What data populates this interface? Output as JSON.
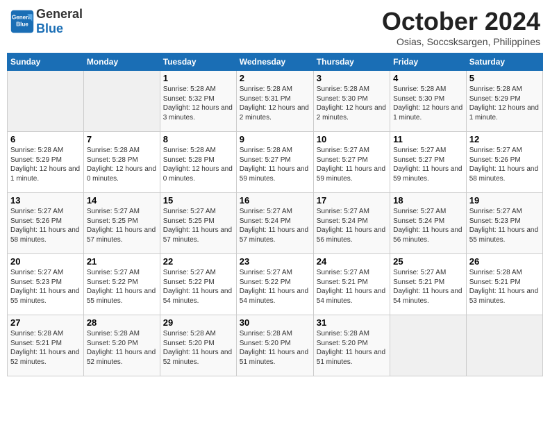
{
  "header": {
    "logo_general": "General",
    "logo_blue": "Blue",
    "month_title": "October 2024",
    "subtitle": "Osias, Soccsksargen, Philippines"
  },
  "days_of_week": [
    "Sunday",
    "Monday",
    "Tuesday",
    "Wednesday",
    "Thursday",
    "Friday",
    "Saturday"
  ],
  "weeks": [
    [
      {
        "day": "",
        "info": ""
      },
      {
        "day": "",
        "info": ""
      },
      {
        "day": "1",
        "info": "Sunrise: 5:28 AM\nSunset: 5:32 PM\nDaylight: 12 hours and 3 minutes."
      },
      {
        "day": "2",
        "info": "Sunrise: 5:28 AM\nSunset: 5:31 PM\nDaylight: 12 hours and 2 minutes."
      },
      {
        "day": "3",
        "info": "Sunrise: 5:28 AM\nSunset: 5:30 PM\nDaylight: 12 hours and 2 minutes."
      },
      {
        "day": "4",
        "info": "Sunrise: 5:28 AM\nSunset: 5:30 PM\nDaylight: 12 hours and 1 minute."
      },
      {
        "day": "5",
        "info": "Sunrise: 5:28 AM\nSunset: 5:29 PM\nDaylight: 12 hours and 1 minute."
      }
    ],
    [
      {
        "day": "6",
        "info": "Sunrise: 5:28 AM\nSunset: 5:29 PM\nDaylight: 12 hours and 1 minute."
      },
      {
        "day": "7",
        "info": "Sunrise: 5:28 AM\nSunset: 5:28 PM\nDaylight: 12 hours and 0 minutes."
      },
      {
        "day": "8",
        "info": "Sunrise: 5:28 AM\nSunset: 5:28 PM\nDaylight: 12 hours and 0 minutes."
      },
      {
        "day": "9",
        "info": "Sunrise: 5:28 AM\nSunset: 5:27 PM\nDaylight: 11 hours and 59 minutes."
      },
      {
        "day": "10",
        "info": "Sunrise: 5:27 AM\nSunset: 5:27 PM\nDaylight: 11 hours and 59 minutes."
      },
      {
        "day": "11",
        "info": "Sunrise: 5:27 AM\nSunset: 5:27 PM\nDaylight: 11 hours and 59 minutes."
      },
      {
        "day": "12",
        "info": "Sunrise: 5:27 AM\nSunset: 5:26 PM\nDaylight: 11 hours and 58 minutes."
      }
    ],
    [
      {
        "day": "13",
        "info": "Sunrise: 5:27 AM\nSunset: 5:26 PM\nDaylight: 11 hours and 58 minutes."
      },
      {
        "day": "14",
        "info": "Sunrise: 5:27 AM\nSunset: 5:25 PM\nDaylight: 11 hours and 57 minutes."
      },
      {
        "day": "15",
        "info": "Sunrise: 5:27 AM\nSunset: 5:25 PM\nDaylight: 11 hours and 57 minutes."
      },
      {
        "day": "16",
        "info": "Sunrise: 5:27 AM\nSunset: 5:24 PM\nDaylight: 11 hours and 57 minutes."
      },
      {
        "day": "17",
        "info": "Sunrise: 5:27 AM\nSunset: 5:24 PM\nDaylight: 11 hours and 56 minutes."
      },
      {
        "day": "18",
        "info": "Sunrise: 5:27 AM\nSunset: 5:24 PM\nDaylight: 11 hours and 56 minutes."
      },
      {
        "day": "19",
        "info": "Sunrise: 5:27 AM\nSunset: 5:23 PM\nDaylight: 11 hours and 55 minutes."
      }
    ],
    [
      {
        "day": "20",
        "info": "Sunrise: 5:27 AM\nSunset: 5:23 PM\nDaylight: 11 hours and 55 minutes."
      },
      {
        "day": "21",
        "info": "Sunrise: 5:27 AM\nSunset: 5:22 PM\nDaylight: 11 hours and 55 minutes."
      },
      {
        "day": "22",
        "info": "Sunrise: 5:27 AM\nSunset: 5:22 PM\nDaylight: 11 hours and 54 minutes."
      },
      {
        "day": "23",
        "info": "Sunrise: 5:27 AM\nSunset: 5:22 PM\nDaylight: 11 hours and 54 minutes."
      },
      {
        "day": "24",
        "info": "Sunrise: 5:27 AM\nSunset: 5:21 PM\nDaylight: 11 hours and 54 minutes."
      },
      {
        "day": "25",
        "info": "Sunrise: 5:27 AM\nSunset: 5:21 PM\nDaylight: 11 hours and 54 minutes."
      },
      {
        "day": "26",
        "info": "Sunrise: 5:28 AM\nSunset: 5:21 PM\nDaylight: 11 hours and 53 minutes."
      }
    ],
    [
      {
        "day": "27",
        "info": "Sunrise: 5:28 AM\nSunset: 5:21 PM\nDaylight: 11 hours and 52 minutes."
      },
      {
        "day": "28",
        "info": "Sunrise: 5:28 AM\nSunset: 5:20 PM\nDaylight: 11 hours and 52 minutes."
      },
      {
        "day": "29",
        "info": "Sunrise: 5:28 AM\nSunset: 5:20 PM\nDaylight: 11 hours and 52 minutes."
      },
      {
        "day": "30",
        "info": "Sunrise: 5:28 AM\nSunset: 5:20 PM\nDaylight: 11 hours and 51 minutes."
      },
      {
        "day": "31",
        "info": "Sunrise: 5:28 AM\nSunset: 5:20 PM\nDaylight: 11 hours and 51 minutes."
      },
      {
        "day": "",
        "info": ""
      },
      {
        "day": "",
        "info": ""
      }
    ]
  ]
}
